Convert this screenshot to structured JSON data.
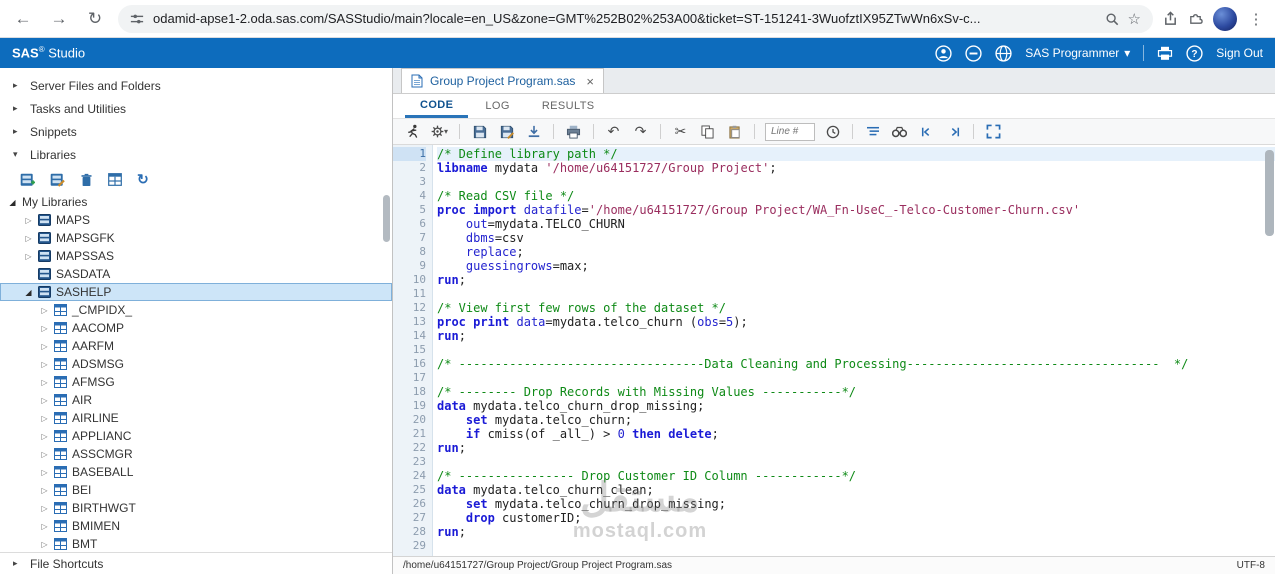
{
  "browser": {
    "url": "odamid-apse1-2.oda.sas.com/SASStudio/main?locale=en_US&zone=GMT%252B02%253A00&ticket=ST-151241-3WuofztIX95ZTwWn6xSv-c..."
  },
  "icons": {
    "back": "←",
    "forward": "→",
    "reload": "↻",
    "kebab": "⋮",
    "star": "☆",
    "caret_down": "▾",
    "collapsed_arrow": "▸",
    "expanded_arrow": "▾",
    "undo": "↶",
    "redo": "↷",
    "cut": "✂",
    "close": "×",
    "refresh": "↻"
  },
  "header": {
    "brand": "SAS",
    "reg": "®",
    "product": "Studio",
    "role": "SAS Programmer",
    "sign_out": "Sign Out"
  },
  "sidebar": {
    "sections": [
      {
        "label": "Server Files and Folders"
      },
      {
        "label": "Tasks and Utilities"
      },
      {
        "label": "Snippets"
      },
      {
        "label": "Libraries"
      }
    ],
    "file_shortcuts": "File Shortcuts",
    "tree": {
      "root": "My Libraries",
      "items": [
        {
          "label": "MAPS",
          "expandable": true
        },
        {
          "label": "MAPSGFK",
          "expandable": true
        },
        {
          "label": "MAPSSAS",
          "expandable": true
        },
        {
          "label": "SASDATA",
          "expandable": false
        },
        {
          "label": "SASHELP",
          "expandable": true,
          "expanded": true,
          "selected": true,
          "children": [
            "_CMPIDX_",
            "AACOMP",
            "AARFM",
            "ADSMSG",
            "AFMSG",
            "AIR",
            "AIRLINE",
            "APPLIANC",
            "ASSCMGR",
            "BASEBALL",
            "BEI",
            "BIRTHWGT",
            "BMIMEN",
            "BMT"
          ]
        }
      ]
    }
  },
  "main": {
    "document_tab": "Group Project Program.sas",
    "view_tabs": [
      "CODE",
      "LOG",
      "RESULTS"
    ],
    "toolbar": {
      "line_number_placeholder": "Line #"
    },
    "status": {
      "path": "/home/u64151727/Group Project/Group Project Program.sas",
      "encoding": "UTF-8"
    }
  },
  "editor": {
    "active_line": 1,
    "lines": [
      {
        "n": 1,
        "tokens": [
          {
            "t": "c",
            "v": "/* Define library path */"
          }
        ]
      },
      {
        "n": 2,
        "tokens": [
          {
            "t": "k",
            "v": "libname"
          },
          {
            "t": "p",
            "v": " mydata "
          },
          {
            "t": "s",
            "v": "'/home/u64151727/Group Project'"
          },
          {
            "t": "p",
            "v": ";"
          }
        ]
      },
      {
        "n": 3,
        "tokens": []
      },
      {
        "n": 4,
        "tokens": [
          {
            "t": "c",
            "v": "/* Read CSV file */"
          }
        ]
      },
      {
        "n": 5,
        "tokens": [
          {
            "t": "k",
            "v": "proc"
          },
          {
            "t": "p",
            "v": " "
          },
          {
            "t": "k",
            "v": "import"
          },
          {
            "t": "p",
            "v": " "
          },
          {
            "t": "o",
            "v": "datafile"
          },
          {
            "t": "p",
            "v": "="
          },
          {
            "t": "s",
            "v": "'/home/u64151727/Group Project/WA_Fn-UseC_-Telco-Customer-Churn.csv'"
          }
        ]
      },
      {
        "n": 6,
        "tokens": [
          {
            "t": "p",
            "v": "    "
          },
          {
            "t": "o",
            "v": "out"
          },
          {
            "t": "p",
            "v": "=mydata.TELCO_CHURN"
          }
        ]
      },
      {
        "n": 7,
        "tokens": [
          {
            "t": "p",
            "v": "    "
          },
          {
            "t": "o",
            "v": "dbms"
          },
          {
            "t": "p",
            "v": "=csv"
          }
        ]
      },
      {
        "n": 8,
        "tokens": [
          {
            "t": "p",
            "v": "    "
          },
          {
            "t": "o",
            "v": "replace"
          },
          {
            "t": "p",
            "v": ";"
          }
        ]
      },
      {
        "n": 9,
        "tokens": [
          {
            "t": "p",
            "v": "    "
          },
          {
            "t": "o",
            "v": "guessingrows"
          },
          {
            "t": "p",
            "v": "=max;"
          }
        ]
      },
      {
        "n": 10,
        "tokens": [
          {
            "t": "k",
            "v": "run"
          },
          {
            "t": "p",
            "v": ";"
          }
        ]
      },
      {
        "n": 11,
        "tokens": []
      },
      {
        "n": 12,
        "tokens": [
          {
            "t": "c",
            "v": "/* View first few rows of the dataset */"
          }
        ]
      },
      {
        "n": 13,
        "tokens": [
          {
            "t": "k",
            "v": "proc"
          },
          {
            "t": "p",
            "v": " "
          },
          {
            "t": "k",
            "v": "print"
          },
          {
            "t": "p",
            "v": " "
          },
          {
            "t": "o",
            "v": "data"
          },
          {
            "t": "p",
            "v": "=mydata.telco_churn ("
          },
          {
            "t": "o",
            "v": "obs"
          },
          {
            "t": "p",
            "v": "="
          },
          {
            "t": "n",
            "v": "5"
          },
          {
            "t": "p",
            "v": ");"
          }
        ]
      },
      {
        "n": 14,
        "tokens": [
          {
            "t": "k",
            "v": "run"
          },
          {
            "t": "p",
            "v": ";"
          }
        ]
      },
      {
        "n": 15,
        "tokens": []
      },
      {
        "n": 16,
        "tokens": [
          {
            "t": "c",
            "v": "/* ----------------------------------Data Cleaning and Processing-----------------------------------  */"
          }
        ]
      },
      {
        "n": 17,
        "tokens": []
      },
      {
        "n": 18,
        "tokens": [
          {
            "t": "c",
            "v": "/* -------- Drop Records with Missing Values -----------*/"
          }
        ]
      },
      {
        "n": 19,
        "tokens": [
          {
            "t": "k",
            "v": "data"
          },
          {
            "t": "p",
            "v": " mydata.telco_churn_drop_missing;"
          }
        ]
      },
      {
        "n": 20,
        "tokens": [
          {
            "t": "p",
            "v": "    "
          },
          {
            "t": "k",
            "v": "set"
          },
          {
            "t": "p",
            "v": " mydata.telco_churn;"
          }
        ]
      },
      {
        "n": 21,
        "tokens": [
          {
            "t": "p",
            "v": "    "
          },
          {
            "t": "k",
            "v": "if"
          },
          {
            "t": "p",
            "v": " cmiss(of _all_) > "
          },
          {
            "t": "n",
            "v": "0"
          },
          {
            "t": "p",
            "v": " "
          },
          {
            "t": "k",
            "v": "then"
          },
          {
            "t": "p",
            "v": " "
          },
          {
            "t": "k",
            "v": "delete"
          },
          {
            "t": "p",
            "v": ";"
          }
        ]
      },
      {
        "n": 22,
        "tokens": [
          {
            "t": "k",
            "v": "run"
          },
          {
            "t": "p",
            "v": ";"
          }
        ]
      },
      {
        "n": 23,
        "tokens": []
      },
      {
        "n": 24,
        "tokens": [
          {
            "t": "c",
            "v": "/* ---------------- Drop Customer ID Column ------------*/"
          }
        ]
      },
      {
        "n": 25,
        "tokens": [
          {
            "t": "k",
            "v": "data"
          },
          {
            "t": "p",
            "v": " mydata.telco_churn_clean;"
          }
        ]
      },
      {
        "n": 26,
        "tokens": [
          {
            "t": "p",
            "v": "    "
          },
          {
            "t": "k",
            "v": "set"
          },
          {
            "t": "p",
            "v": " mydata.telco_churn_drop_missing;"
          }
        ]
      },
      {
        "n": 27,
        "tokens": [
          {
            "t": "p",
            "v": "    "
          },
          {
            "t": "k",
            "v": "drop"
          },
          {
            "t": "p",
            "v": " customerID;"
          }
        ]
      },
      {
        "n": 28,
        "tokens": [
          {
            "t": "k",
            "v": "run"
          },
          {
            "t": "p",
            "v": ";"
          }
        ]
      },
      {
        "n": 29,
        "tokens": []
      }
    ]
  },
  "watermark": {
    "title": "مستقل",
    "domain": "mostaql.com"
  }
}
